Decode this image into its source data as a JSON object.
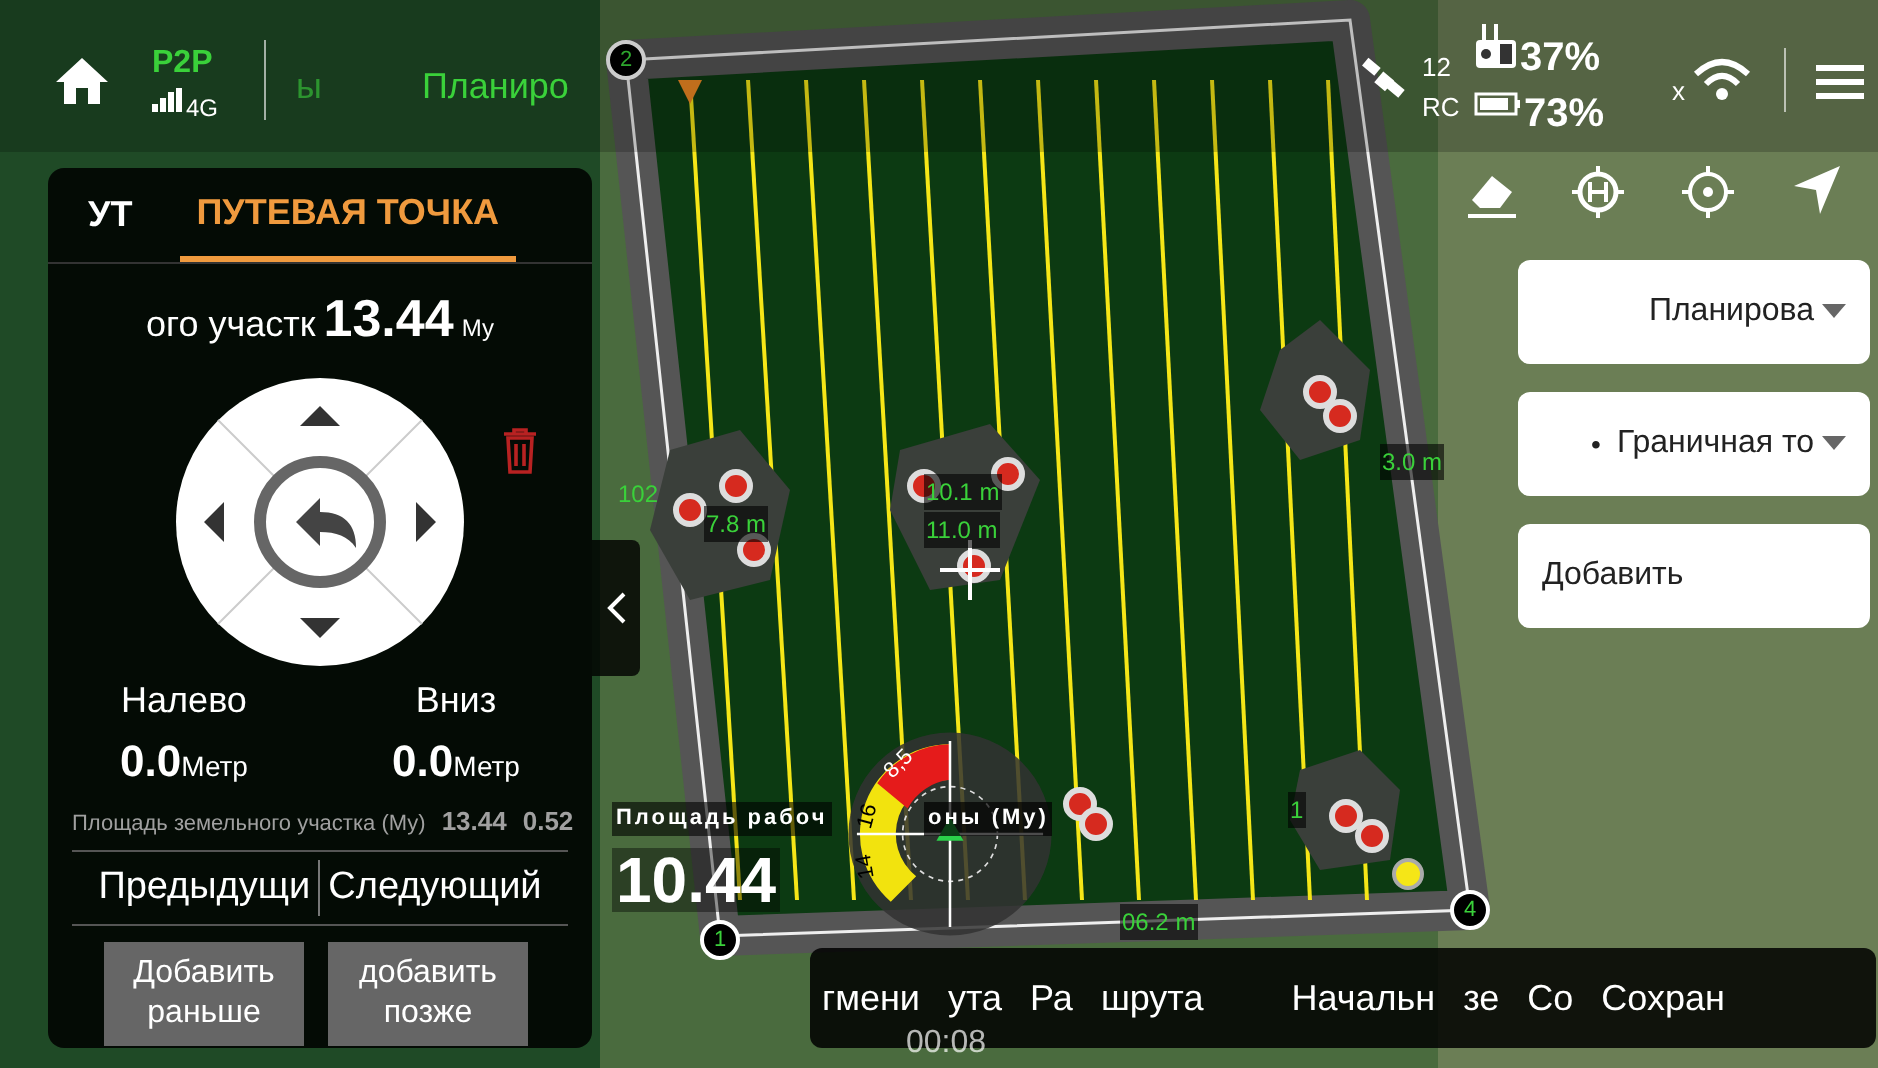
{
  "top_bar": {
    "link": "P2P",
    "network": "4G",
    "tabs": [
      {
        "label": "ы",
        "selected": false
      },
      {
        "label": "Планиро",
        "selected": true
      }
    ],
    "satellites": "12",
    "rc_label": "RC",
    "rc_battery": "37%",
    "drone_battery": "73%",
    "wifi_label": "x"
  },
  "map": {
    "vertices": [
      "1",
      "2",
      "4"
    ],
    "labels": [
      "102",
      "7.8 m",
      "10.1 m",
      "11.0 m",
      "3.0 m",
      "1",
      "06.2 m"
    ],
    "work_area_label": "Площадь рабоч",
    "work_area_suffix": "оны (Му)",
    "work_area_value": "10.44",
    "ghost_area_label": "Площадь земельного участка (Му)",
    "ghost_area_value": "13.44",
    "ghost_small_value": "0.52",
    "time": "00:08"
  },
  "gauge": {
    "ticks": [
      "8,5",
      "16",
      "14"
    ]
  },
  "panel": {
    "tabs": [
      {
        "label": "УТ",
        "selected": false
      },
      {
        "label": "ПУТЕВАЯ ТОЧКА",
        "selected": true
      }
    ],
    "area_label": "ого участк",
    "area_value": "13.44",
    "area_unit": "Му",
    "offsets": [
      {
        "label": "Налево",
        "value": "0.0",
        "unit": "Метр"
      },
      {
        "label": "Вниз",
        "value": "0.0",
        "unit": "Метр"
      }
    ],
    "nav": [
      "Предыдущи",
      "Следующий"
    ],
    "buttons": [
      "Добавить раньше",
      "добавить позже"
    ]
  },
  "right": {
    "controls": [
      {
        "kind": "select",
        "label": "Планирова"
      },
      {
        "kind": "select",
        "bullet": "•",
        "label": "Граничная то"
      },
      {
        "kind": "button",
        "label": "Добавить"
      }
    ]
  },
  "bottom_bar": {
    "items": [
      "гмени",
      "ута",
      "Ра",
      "шрута",
      "Начальн",
      "зе",
      "Со",
      "Сохран"
    ]
  }
}
